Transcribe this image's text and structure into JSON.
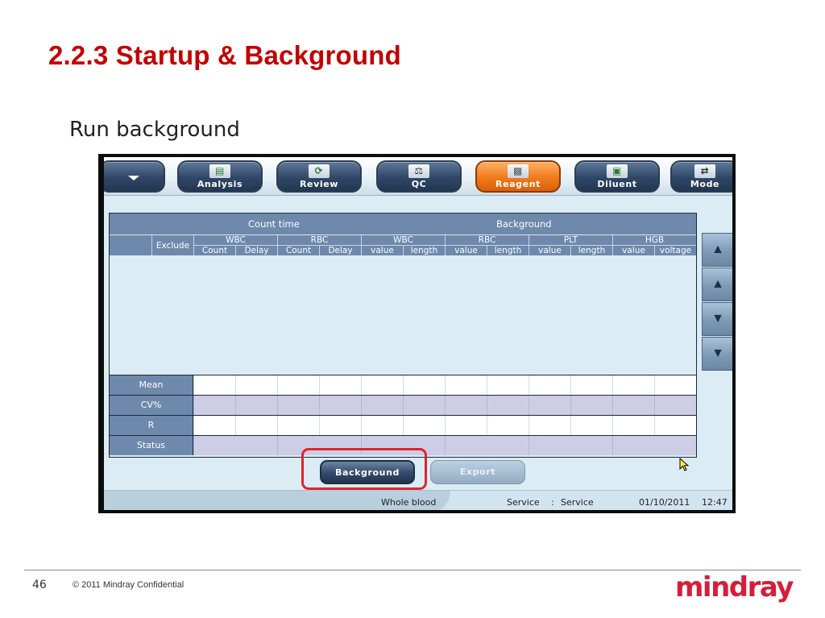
{
  "slide": {
    "title": "2.2.3 Startup & Background",
    "subtitle": "Run background",
    "page_number": "46",
    "copyright": "© 2011 Mindray Confidential",
    "logo_text": "mindray"
  },
  "toolbar": {
    "items": [
      {
        "label": "",
        "icon": "chevron-down-icon"
      },
      {
        "label": "Analysis",
        "icon": "chart-icon"
      },
      {
        "label": "Review",
        "icon": "refresh-icon"
      },
      {
        "label": "QC",
        "icon": "scale-icon"
      },
      {
        "label": "Reagent",
        "icon": "reagent-bottles-icon",
        "active": true
      },
      {
        "label": "Diluent",
        "icon": "diluent-icon"
      },
      {
        "label": "Mode",
        "icon": "arrows-icon"
      }
    ]
  },
  "table": {
    "group_headers": {
      "count_time": "Count time",
      "background": "Background"
    },
    "exclude": "Exclude",
    "param_groups": [
      "WBC",
      "RBC",
      "WBC",
      "RBC",
      "PLT",
      "HGB"
    ],
    "sub_headers": [
      "Count",
      "Delay",
      "Count",
      "Delay",
      "value",
      "length",
      "value",
      "length",
      "value",
      "length",
      "value",
      "voltage"
    ],
    "stat_rows": [
      "Mean",
      "CV%",
      "R",
      "Status"
    ]
  },
  "buttons": {
    "background": "Background",
    "export": "Export"
  },
  "status_bar": {
    "mode": "Whole  blood",
    "user_label": "Service",
    "separator": ":",
    "user_value": "Service",
    "date": "01/10/2011",
    "time": "12:47"
  },
  "colors": {
    "title_red": "#c00000",
    "active_orange": "#f07a1c",
    "highlight_red": "#e0242d",
    "header_blue": "#6e89ab",
    "logo_red": "#d31f3a"
  }
}
